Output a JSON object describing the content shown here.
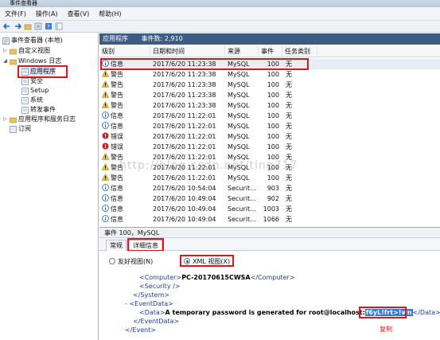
{
  "window": {
    "title": "事件查看器"
  },
  "menu": [
    "文件(F)",
    "操作(A)",
    "查看(V)",
    "帮助(H)"
  ],
  "tree": {
    "items": [
      {
        "label": "事件查看器 (本地)",
        "expand": ""
      },
      {
        "label": "自定义视图",
        "expand": "▷"
      },
      {
        "label": "Windows 日志",
        "expand": "◢"
      },
      {
        "label": "应用程序",
        "expand": ""
      },
      {
        "label": "安全",
        "expand": ""
      },
      {
        "label": "Setup",
        "expand": ""
      },
      {
        "label": "系统",
        "expand": ""
      },
      {
        "label": "转发事件",
        "expand": ""
      },
      {
        "label": "应用程序和服务日志",
        "expand": "▷"
      },
      {
        "label": "订阅",
        "expand": ""
      }
    ]
  },
  "pane_header": {
    "name": "应用程序",
    "count": "事件数: 2,910"
  },
  "columns": [
    "级别",
    "日期和时间",
    "来源",
    "事件 ID",
    "任务类别"
  ],
  "rows": [
    {
      "level": "信息",
      "icon": "info-icon",
      "datetime": "2017/6/20 11:23:38",
      "source": "MySQL",
      "id": "100",
      "category": "无"
    },
    {
      "level": "警告",
      "icon": "warning-icon",
      "datetime": "2017/6/20 11:23:38",
      "source": "MySQL",
      "id": "100",
      "category": "无"
    },
    {
      "level": "警告",
      "icon": "warning-icon",
      "datetime": "2017/6/20 11:23:38",
      "source": "MySQL",
      "id": "100",
      "category": "无"
    },
    {
      "level": "警告",
      "icon": "warning-icon",
      "datetime": "2017/6/20 11:23:38",
      "source": "MySQL",
      "id": "100",
      "category": "无"
    },
    {
      "level": "警告",
      "icon": "warning-icon",
      "datetime": "2017/6/20 11:23:38",
      "source": "MySQL",
      "id": "100",
      "category": "无"
    },
    {
      "level": "信息",
      "icon": "info-icon",
      "datetime": "2017/6/20 11:22:01",
      "source": "MySQL",
      "id": "100",
      "category": "无"
    },
    {
      "level": "信息",
      "icon": "info-icon",
      "datetime": "2017/6/20 11:22:01",
      "source": "MySQL",
      "id": "100",
      "category": "无"
    },
    {
      "level": "错误",
      "icon": "error-icon",
      "datetime": "2017/6/20 11:22:01",
      "source": "MySQL",
      "id": "100",
      "category": "无"
    },
    {
      "level": "错误",
      "icon": "error-icon",
      "datetime": "2017/6/20 11:22:01",
      "source": "MySQL",
      "id": "100",
      "category": "无"
    },
    {
      "level": "警告",
      "icon": "warning-icon",
      "datetime": "2017/6/20 11:22:01",
      "source": "MySQL",
      "id": "100",
      "category": "无"
    },
    {
      "level": "警告",
      "icon": "warning-icon",
      "datetime": "2017/6/20 11:22:01",
      "source": "MySQL",
      "id": "100",
      "category": "无"
    },
    {
      "level": "警告",
      "icon": "warning-icon",
      "datetime": "2017/6/20 11:22:01",
      "source": "MySQL",
      "id": "100",
      "category": "无"
    },
    {
      "level": "信息",
      "icon": "info-icon",
      "datetime": "2017/6/20 10:54:04",
      "source": "Securit...",
      "id": "903",
      "category": "无"
    },
    {
      "level": "信息",
      "icon": "info-icon",
      "datetime": "2017/6/20 10:49:04",
      "source": "Securit...",
      "id": "902",
      "category": "无"
    },
    {
      "level": "信息",
      "icon": "info-icon",
      "datetime": "2017/6/20 10:49:04",
      "source": "Securit...",
      "id": "1003",
      "category": "无"
    },
    {
      "level": "信息",
      "icon": "info-icon",
      "datetime": "2017/6/20 10:49:04",
      "source": "Securit...",
      "id": "1066",
      "category": "无"
    }
  ],
  "watermark": "http://blog.csdn.net/ting717",
  "detail": {
    "title": "事件 100，MySQL",
    "tabs": [
      "常规",
      "详细信息"
    ],
    "radio_friendly": "友好视图(N)",
    "radio_xml": "XML 视图(X)",
    "xml": {
      "computer_open": "<Computer>",
      "computer_value": "PC-20170615CWSA",
      "computer_close": "</Computer>",
      "security": "<Security />",
      "system_close": "</System>",
      "eventdata_toggle": "-",
      "eventdata_open": "<EventData>",
      "data_open": "<Data>",
      "data_text": "A temporary password is generated for root@localhost:",
      "password": "f6yL!frt>!wn",
      "data_close": "</Data>",
      "eventdata_close": "</EventData>",
      "event_close": "</Event>"
    },
    "copy_label": "复制"
  }
}
